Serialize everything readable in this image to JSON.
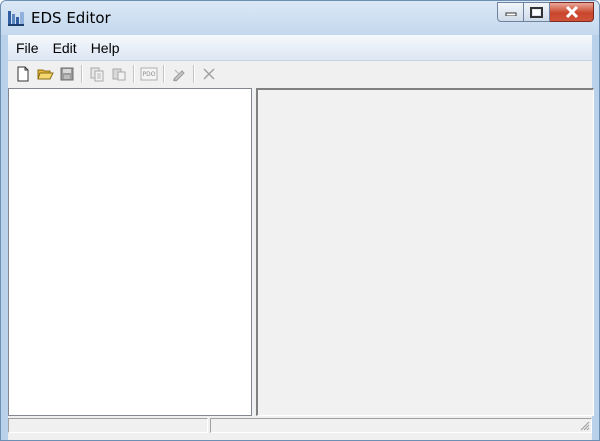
{
  "window": {
    "title": "EDS Editor",
    "colors": {
      "frame": "#b9d1ea",
      "close": "#c9462c",
      "client": "#f0f0f0",
      "pane": "#ffffff"
    }
  },
  "menubar": {
    "items": [
      {
        "label": "File"
      },
      {
        "label": "Edit"
      },
      {
        "label": "Help"
      }
    ]
  },
  "toolbar": {
    "buttons": [
      {
        "icon": "new-file-icon",
        "enabled": true
      },
      {
        "icon": "open-folder-icon",
        "enabled": true
      },
      {
        "icon": "save-icon",
        "enabled": false
      },
      {
        "icon": "copy-icon",
        "enabled": false
      },
      {
        "icon": "paste-icon",
        "enabled": false
      },
      {
        "icon": "pdo-icon",
        "enabled": false,
        "label": "PDO"
      },
      {
        "icon": "edit-pen-icon",
        "enabled": false
      },
      {
        "icon": "delete-x-icon",
        "enabled": false
      }
    ]
  },
  "statusbar": {
    "panels": [
      "",
      ""
    ]
  }
}
